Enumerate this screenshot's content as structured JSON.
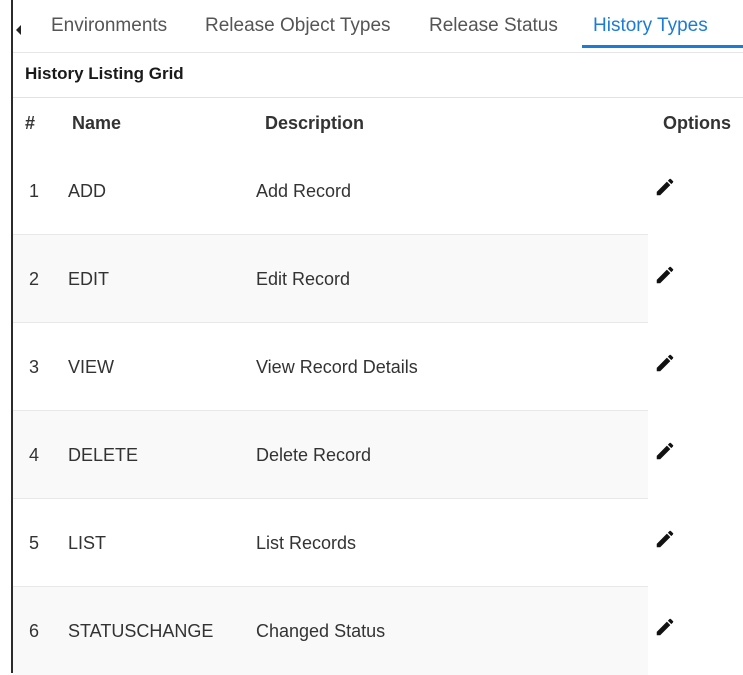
{
  "tabs": [
    {
      "label": "Environments",
      "active": false
    },
    {
      "label": "Release Object Types",
      "active": false
    },
    {
      "label": "Release Status",
      "active": false
    },
    {
      "label": "History Types",
      "active": true
    }
  ],
  "grid": {
    "title": "History Listing Grid",
    "columns": {
      "num": "#",
      "name": "Name",
      "description": "Description",
      "options": "Options"
    },
    "rows": [
      {
        "num": "1",
        "name": "ADD",
        "description": "Add Record"
      },
      {
        "num": "2",
        "name": "EDIT",
        "description": "Edit Record"
      },
      {
        "num": "3",
        "name": "VIEW",
        "description": "View Record Details"
      },
      {
        "num": "4",
        "name": "DELETE",
        "description": "Delete Record"
      },
      {
        "num": "5",
        "name": "LIST",
        "description": "List Records"
      },
      {
        "num": "6",
        "name": "STATUSCHANGE",
        "description": "Changed Status"
      }
    ],
    "row_action_icon": "pencil-icon"
  },
  "colors": {
    "accent": "#1c7cd5",
    "text": "#333333",
    "row_alt": "#f9f9f9"
  }
}
